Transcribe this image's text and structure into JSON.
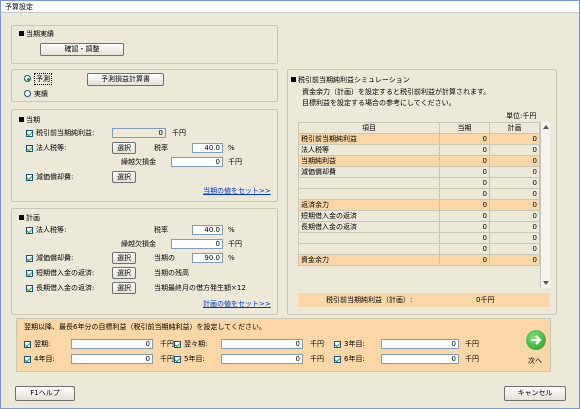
{
  "window": {
    "title": "予算設定"
  },
  "current_results": {
    "heading": "当期実績",
    "confirm_button": "確認・調整"
  },
  "mode": {
    "forecast_label": "予測",
    "actual_label": "実績",
    "forecast_calc_button": "予測損益計算書"
  },
  "current": {
    "heading": "当期",
    "pretax_label": "税引前当期純利益:",
    "pretax_value": "0",
    "pretax_unit": "千円",
    "corp_tax_label": "法人税等:",
    "corp_tax_select": "選択",
    "rate_label": "税率",
    "rate_value": "40.0",
    "rate_unit": "%",
    "deficit_label": "繰越欠損金",
    "deficit_value": "0",
    "deficit_unit": "千円",
    "depreciation_label": "減価償却費:",
    "depreciation_select": "選択",
    "set_link": "当期の値をセット>>"
  },
  "plan": {
    "heading": "計画",
    "corp_tax_label": "法人税等:",
    "rate_label": "税率",
    "rate_value": "40.0",
    "rate_unit": "%",
    "deficit_label": "繰越欠損金",
    "deficit_value": "0",
    "deficit_unit": "千円",
    "depreciation_label": "減価償却費:",
    "depreciation_select": "選択",
    "dep_text": "当期の",
    "dep_value": "90.0",
    "dep_unit": "%",
    "short_loan_label": "短期借入金の返済:",
    "short_loan_select": "選択",
    "short_loan_text": "当期の残高",
    "long_loan_label": "長期借入金の返済:",
    "long_loan_select": "選択",
    "long_loan_text": "当期最終月の借方発生額×12",
    "set_link": "計画の値をセット>>"
  },
  "simulation": {
    "heading": "税引前当期純利益シミュレーション",
    "desc1": "資金余力（計画）を設定すると税引前利益が計算されます。",
    "desc2": "目標利益を設定する場合の参考にしてください。",
    "unit": "単位:千円",
    "headers": [
      "項目",
      "当期",
      "計画"
    ],
    "rows": [
      {
        "name": "税引前当期純利益",
        "current": "0",
        "plan": "0"
      },
      {
        "name": "法人税等",
        "current": "0",
        "plan": "0"
      },
      {
        "name": "当期純利益",
        "current": "0",
        "plan": "0"
      },
      {
        "name": "減価償却費",
        "current": "0",
        "plan": "0"
      },
      {
        "name": "",
        "current": "0",
        "plan": "0"
      },
      {
        "name": "",
        "current": "0",
        "plan": "0"
      },
      {
        "name": "返済余力",
        "current": "0",
        "plan": "0"
      },
      {
        "name": "短期借入金の返済",
        "current": "0",
        "plan": "0"
      },
      {
        "name": "長期借入金の返済",
        "current": "0",
        "plan": "0"
      },
      {
        "name": "",
        "current": "0",
        "plan": "0"
      },
      {
        "name": "",
        "current": "0",
        "plan": "0"
      },
      {
        "name": "資金余力",
        "current": "0",
        "plan": "0"
      }
    ],
    "footer_label": "税引前当期純利益（計画）:",
    "footer_value": "0千円"
  },
  "future": {
    "instruction": "翌期以降、最長6年分の目標利益（税引前当期純利益）を設定してください。",
    "items": [
      {
        "label": "翌期:",
        "value": "0",
        "unit": "千円"
      },
      {
        "label": "翌々期:",
        "value": "0",
        "unit": "千円"
      },
      {
        "label": "3年目:",
        "value": "0",
        "unit": "千円"
      },
      {
        "label": "4年目:",
        "value": "0",
        "unit": "千円"
      },
      {
        "label": "5年目:",
        "value": "0",
        "unit": "千円"
      },
      {
        "label": "6年目:",
        "value": "0",
        "unit": "千円"
      }
    ]
  },
  "nav": {
    "next_label": "次へ"
  },
  "footer": {
    "help_button": "F1ヘルプ",
    "cancel_button": "キャンセル"
  },
  "colors": {
    "highlight": "#fbd7a8",
    "next_icon": "#21a121"
  }
}
